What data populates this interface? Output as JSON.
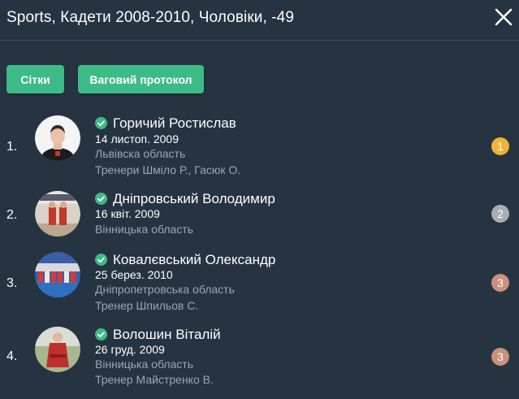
{
  "header": {
    "title": "Sports, Кадети 2008-2010, Чоловіки, -49"
  },
  "toolbar": {
    "grids_label": "Сітки",
    "weigh_label": "Ваговий протокол"
  },
  "colors": {
    "background": "#263442",
    "accent": "#3dbb86",
    "gold": "#f0b43a",
    "silver": "#a9acb1",
    "bronze": "#c9917a"
  },
  "athletes": [
    {
      "rank": "1.",
      "name": "Горичий Ростислав",
      "dob": "14 листоп. 2009",
      "region": "Львівска область",
      "coaches": "Тренери Шміло Р.,  Гасюк О.",
      "place": "1",
      "verified_icon": "check-circle-icon"
    },
    {
      "rank": "2.",
      "name": "Дніпровський Володимир",
      "dob": "16 квіт. 2009",
      "region": "Вінницька область",
      "coaches": "",
      "place": "2",
      "verified_icon": "check-circle-icon"
    },
    {
      "rank": "3.",
      "name": "Ковалєвський Олександр",
      "dob": "25 берез. 2010",
      "region": "Дніпропетровська область",
      "coaches": "Тренер Шпильов С.",
      "place": "3",
      "verified_icon": "check-circle-icon"
    },
    {
      "rank": "4.",
      "name": "Волошин Віталій",
      "dob": "26 груд. 2009",
      "region": "Вінницька область",
      "coaches": "Тренер Майстренко В.",
      "place": "3",
      "verified_icon": "check-circle-icon"
    }
  ]
}
